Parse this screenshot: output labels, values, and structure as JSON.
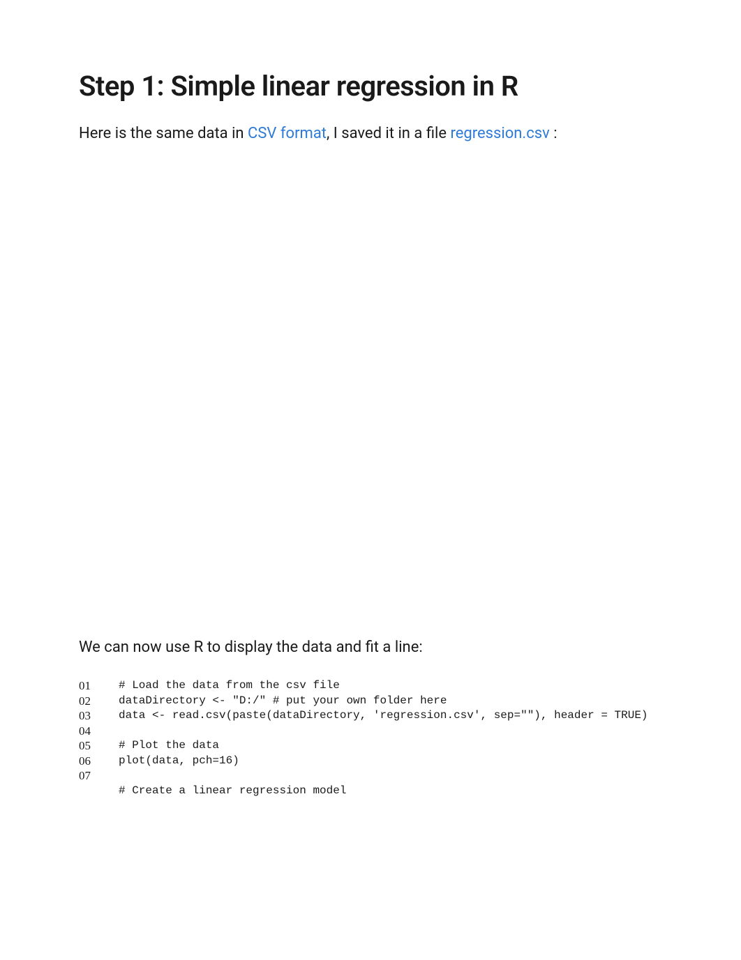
{
  "heading": "Step 1: Simple linear regression in R",
  "intro": {
    "text_before_link1": "Here is the same data in ",
    "link1_text": "CSV format",
    "text_mid": ", I saved it in a file ",
    "link2_text": "regression.csv",
    "text_after": " :"
  },
  "body_text": "We can now use R to display the data and fit a line:",
  "code": {
    "line_numbers": "01\n02\n03\n04\n05\n06\n07",
    "lines": "# Load the data from the csv file\ndataDirectory <- \"D:/\" # put your own folder here\ndata <- read.csv(paste(dataDirectory, 'regression.csv', sep=\"\"), header = TRUE)\n\n# Plot the data\nplot(data, pch=16)\n\n# Create a linear regression model"
  }
}
